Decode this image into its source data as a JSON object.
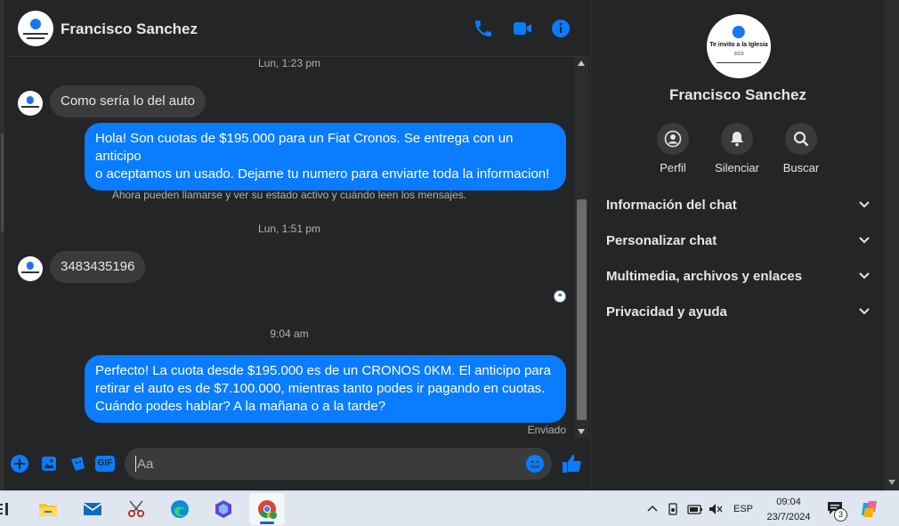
{
  "contact": {
    "name": "Francisco Sanchez"
  },
  "avatar_text": {
    "line1": "Te invito a la Iglesia",
    "line2": "2023"
  },
  "messages": {
    "ts1": "Lun, 1:23 pm",
    "in1": "Como sería lo del auto",
    "out1_line1": "Hola! Son cuotas de $195.000 para un Fiat Cronos. Se entrega con un anticipo",
    "out1_line2": "o aceptamos un usado. Dejame tu numero para enviarte toda la informacion!",
    "system": "Ahora pueden llamarse y ver su estado activo y cuándo leen los mensajes.",
    "ts2": "Lun, 1:51 pm",
    "in2": "3483435196",
    "ts3": "9:04 am",
    "out2_line1": "Perfecto! La cuota desde $195.000 es de un CRONOS 0KM. El anticipo para",
    "out2_line2": "retirar el auto es de $7.100.000, mientras tanto podes ir pagando en cuotas.",
    "out2_line3": "Cuándo podes hablar? A la mañana o a la tarde?",
    "status": "Enviado"
  },
  "composer": {
    "placeholder": "Aa",
    "icons": [
      "plus-circle-icon",
      "image-icon",
      "sticker-icon",
      "gif-icon",
      "emoji-icon",
      "thumbs-up-icon"
    ],
    "gif_label": "GIF"
  },
  "info_panel": {
    "actions": [
      {
        "label": "Perfil",
        "icon": "profile-icon"
      },
      {
        "label": "Silenciar",
        "icon": "bell-icon"
      },
      {
        "label": "Buscar",
        "icon": "search-icon"
      }
    ],
    "sections": [
      {
        "label": "Información del chat"
      },
      {
        "label": "Personalizar chat"
      },
      {
        "label": "Multimedia, archivos y enlaces"
      },
      {
        "label": "Privacidad y ayuda"
      }
    ]
  },
  "taskbar": {
    "apps": [
      "file-explorer-icon",
      "mail-icon",
      "snipping-tool-icon",
      "edge-icon",
      "copilot-icon",
      "chrome-icon"
    ],
    "lang": "ESP",
    "time": "09:04",
    "date": "23/7/2024",
    "notifications": "3"
  },
  "colors": {
    "accent": "#0a7cff",
    "panel": "#242526",
    "bubble_in": "#3a3b3c"
  }
}
